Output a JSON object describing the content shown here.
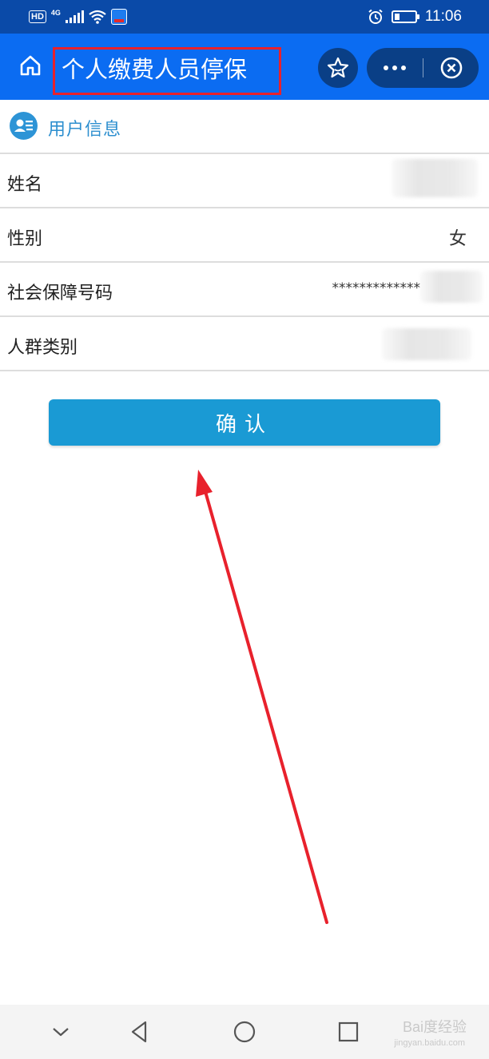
{
  "status_bar": {
    "hd": "HD",
    "network": "4G",
    "time": "11:06",
    "icons": [
      "signal-icon",
      "wifi-icon",
      "app-notification-icon",
      "alarm-icon",
      "battery-icon"
    ]
  },
  "header": {
    "title": "个人缴费人员停保",
    "icons": [
      "home-icon",
      "star-icon",
      "more-icon",
      "close-circle-icon"
    ],
    "bg_color": "#0b6cf2"
  },
  "section": {
    "title": "用户信息",
    "icon": "user-card-icon",
    "title_color": "#2d8fcf"
  },
  "fields": [
    {
      "label": "姓名",
      "value": ""
    },
    {
      "label": "性别",
      "value": "女"
    },
    {
      "label": "社会保障号码",
      "value": "*************"
    },
    {
      "label": "人群类别",
      "value": ""
    }
  ],
  "confirm": {
    "label": "确认",
    "color": "#1a9ad4"
  },
  "annotation": {
    "color": "#e8212c"
  },
  "nav": {
    "icons": [
      "chevron-down-icon",
      "back-triangle-icon",
      "home-circle-icon",
      "recents-square-icon"
    ],
    "watermark": "Bai度经验",
    "watermark_sub": "jingyan.baidu.com"
  }
}
